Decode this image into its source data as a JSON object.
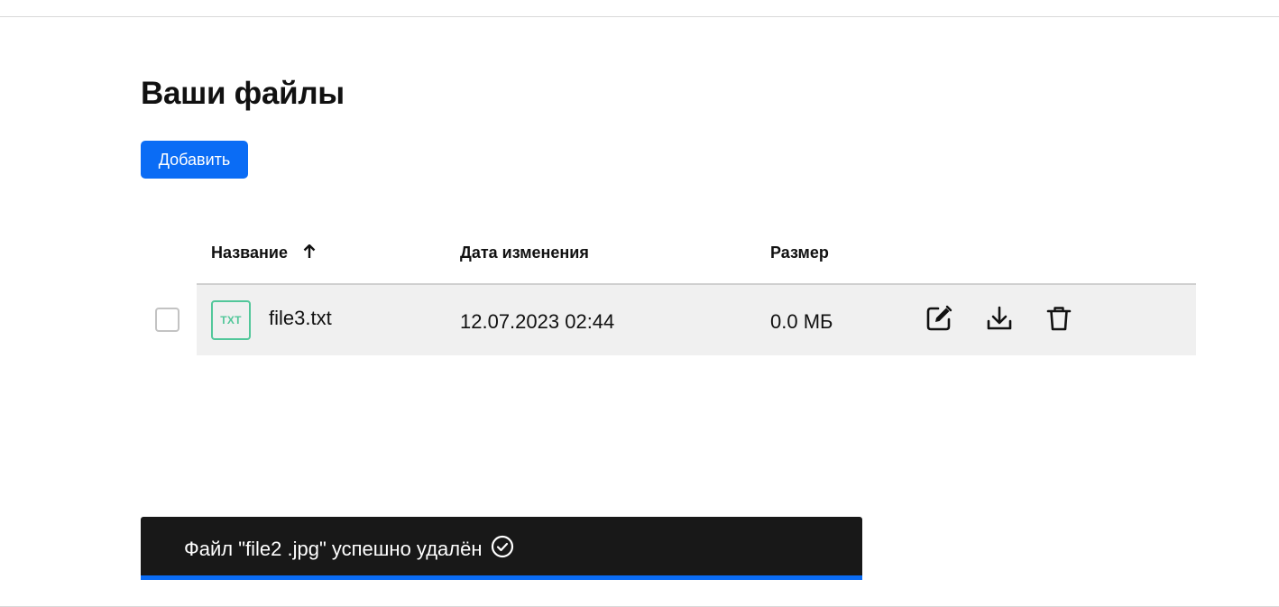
{
  "page": {
    "title": "Ваши файлы"
  },
  "toolbar": {
    "add_label": "Добавить"
  },
  "table": {
    "columns": {
      "name": "Название",
      "date": "Дата изменения",
      "size": "Размер"
    },
    "sort": {
      "column": "name",
      "direction": "ascending",
      "icon": "arrow-up-icon"
    },
    "rows": [
      {
        "selected": false,
        "type_badge": "TXT",
        "name": "file3.txt",
        "modified": "12.07.2023 02:44",
        "size": "0.0 МБ",
        "actions": [
          "edit-icon",
          "download-icon",
          "trash-icon"
        ]
      }
    ]
  },
  "toast": {
    "message": "Файл \"file2 .jpg\" успешно удалён",
    "icon": "check-circle-icon",
    "progress": 1.0
  },
  "colors": {
    "accent": "#0a6cf5",
    "txt_badge": "#52c79a",
    "row_background": "#f0f0f0",
    "toast_background": "#181818"
  }
}
